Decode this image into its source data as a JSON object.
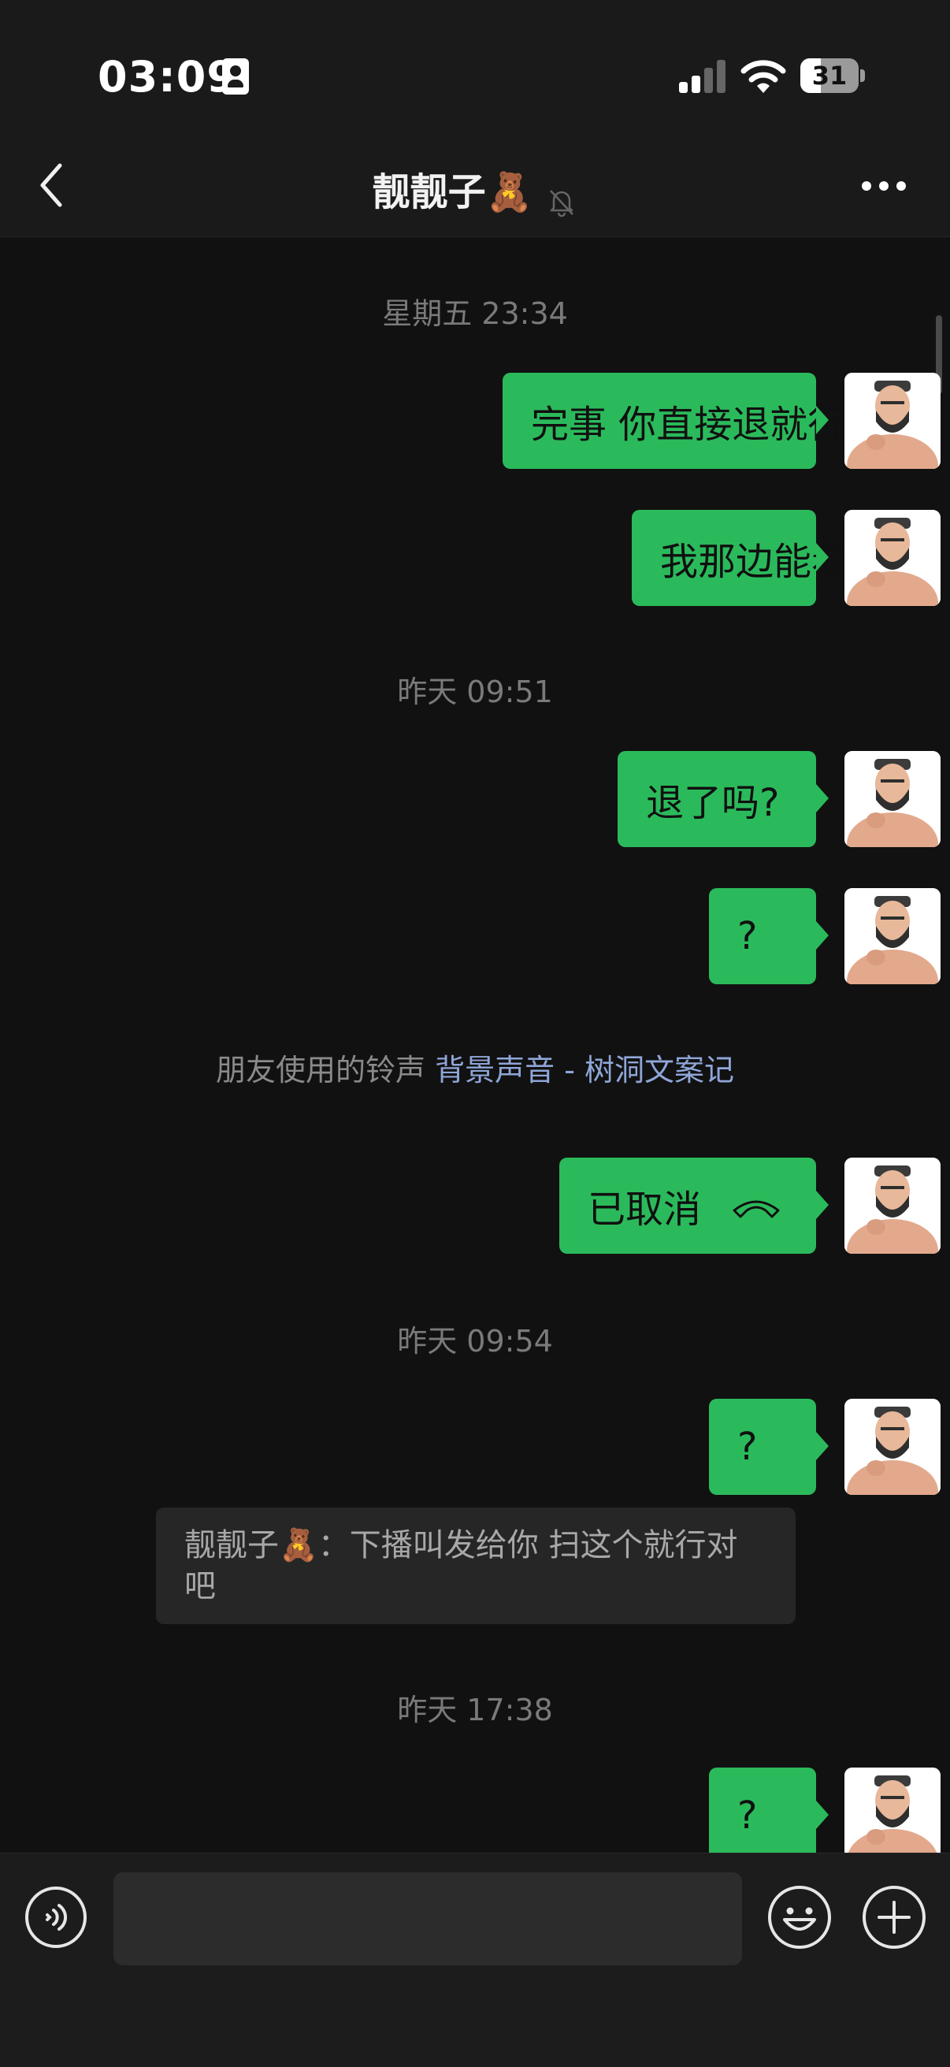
{
  "status": {
    "time": "03:09",
    "battery": "31"
  },
  "header": {
    "title": "靓靓子🧸"
  },
  "chat": {
    "ts1": "星期五 23:34",
    "m1": "完事 你直接退就行了",
    "m2": "我那边能看到",
    "ts2": "昨天 09:51",
    "m3": "退了吗?",
    "m4": "?",
    "ringtone": {
      "prefix": "朋友使用的铃声 ",
      "link": "背景声音 - 树洞文案记"
    },
    "call": {
      "label": "已取消"
    },
    "ts3": "昨天 09:54",
    "m5": "?",
    "quote": "靓靓子🧸：下播叫发给你 扫这个就行对吧",
    "ts4": "昨天 17:38",
    "m6": "?"
  },
  "colors": {
    "bubble": "#2bba5b",
    "background": "#111111",
    "link": "#8fa6d8"
  }
}
